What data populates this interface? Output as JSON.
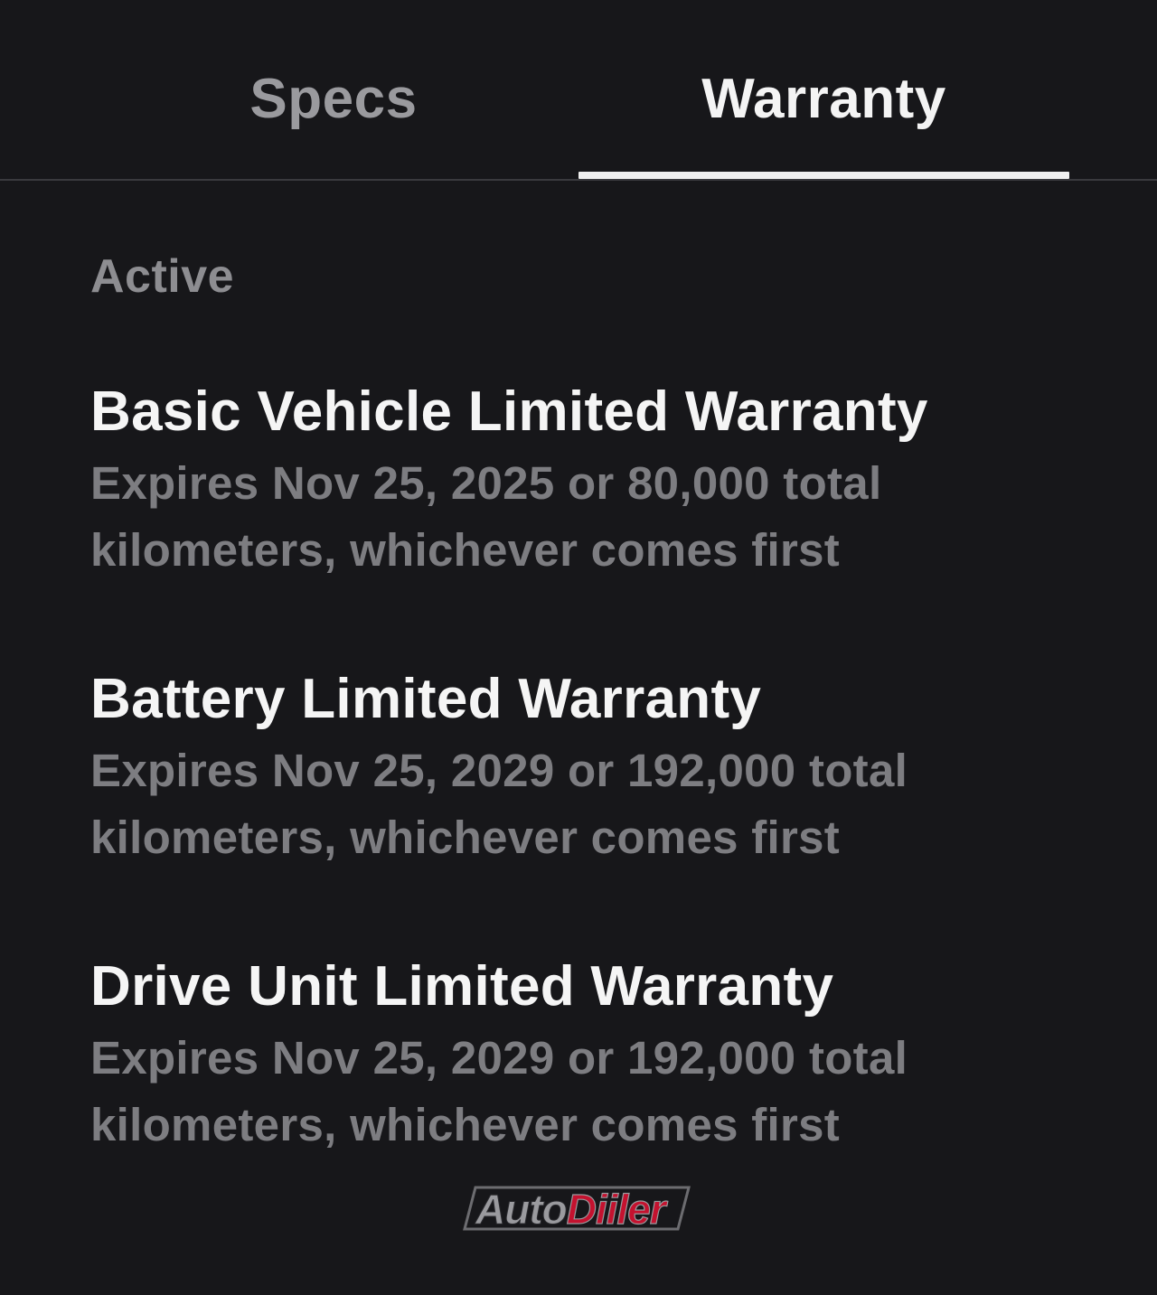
{
  "tabs": [
    {
      "label": "Specs",
      "active": false
    },
    {
      "label": "Warranty",
      "active": true
    }
  ],
  "section": {
    "label": "Active"
  },
  "warranties": [
    {
      "title": "Basic Vehicle Limited Warranty",
      "description": "Expires Nov 25, 2025 or 80,000 total kilometers, whichever comes first"
    },
    {
      "title": "Battery Limited Warranty",
      "description": "Expires Nov 25, 2029 or 192,000 total kilometers, whichever comes first"
    },
    {
      "title": "Drive Unit Limited Warranty",
      "description": "Expires Nov 25, 2029 or 192,000 total kilometers, whichever comes first"
    }
  ],
  "watermark": {
    "part1": "Auto",
    "part2": "Diiler"
  },
  "colors": {
    "background": "#17171a",
    "active_text": "#f4f4f4",
    "inactive_text": "#9a9a9e",
    "secondary_text": "#7d7d81",
    "watermark_red": "#c4122f"
  }
}
